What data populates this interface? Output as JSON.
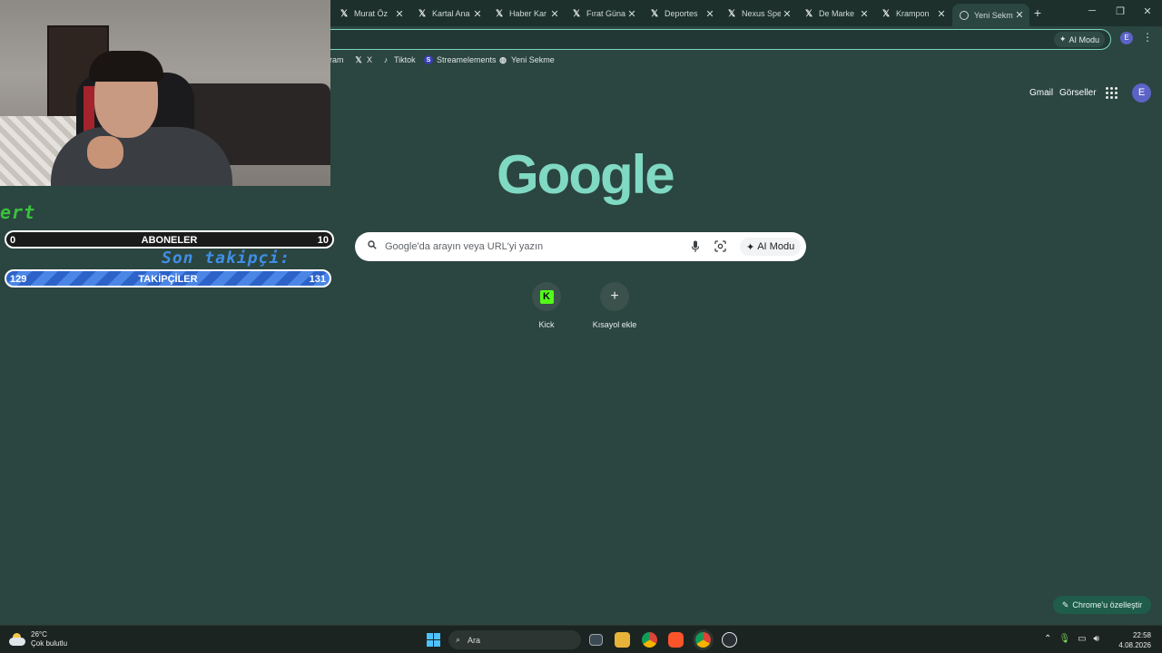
{
  "browser": {
    "tabs": [
      {
        "title": "Murat Öz",
        "icon": "x-logo-icon"
      },
      {
        "title": "Kartal Ana",
        "icon": "x-logo-icon"
      },
      {
        "title": "Haber Kar",
        "icon": "x-logo-icon"
      },
      {
        "title": "Fırat Güna",
        "icon": "x-logo-icon"
      },
      {
        "title": "Deportes",
        "icon": "x-logo-icon"
      },
      {
        "title": "Nexus Spe",
        "icon": "x-logo-icon"
      },
      {
        "title": "De Marke",
        "icon": "x-logo-icon"
      },
      {
        "title": "Krampon",
        "icon": "x-logo-icon"
      },
      {
        "title": "Yeni Sekm",
        "icon": "chrome-tab-icon",
        "active": true
      }
    ],
    "new_tab": "+",
    "omnibox_ai_label": "AI Modu",
    "profile_initial": "E",
    "bookmarks": [
      {
        "label": "ram",
        "icon": ""
      },
      {
        "label": "X",
        "icon": "x-logo-icon"
      },
      {
        "label": "Tiktok",
        "icon": "tiktok-icon"
      },
      {
        "label": "Streamelements",
        "icon": "streamelements-icon"
      },
      {
        "label": "Yeni Sekme",
        "icon": "globe-icon"
      }
    ]
  },
  "ntp": {
    "header_links": [
      "Gmail",
      "Görseller"
    ],
    "profile_initial": "E",
    "logo_text": "Google",
    "search_placeholder": "Google'da arayın veya URL'yi yazın",
    "ai_mode_label": "AI Modu",
    "shortcuts": [
      {
        "label": "Kick",
        "icon": "kick-icon"
      },
      {
        "label": "Kısayol ekle",
        "icon": "plus-icon"
      }
    ],
    "customize_label": "Chrome'u özelleştir"
  },
  "stream_overlay": {
    "green_text": "ert",
    "subs": {
      "left": "0",
      "label": "ABONELER",
      "right": "10"
    },
    "last_follower": "Son takipçi: ",
    "followers": {
      "left": "129",
      "label": "TAKİPÇİLER",
      "right": "131"
    }
  },
  "taskbar": {
    "weather_temp": "26°C",
    "weather_desc": "Çok bulutlu",
    "search_label": "Ara",
    "time": "22:58",
    "date": "4.08.2026"
  },
  "colors": {
    "page_bg": "#2b4540",
    "accent": "#80d9c2",
    "followers_bar": "#2d63c9",
    "profile": "#5b63c7"
  }
}
